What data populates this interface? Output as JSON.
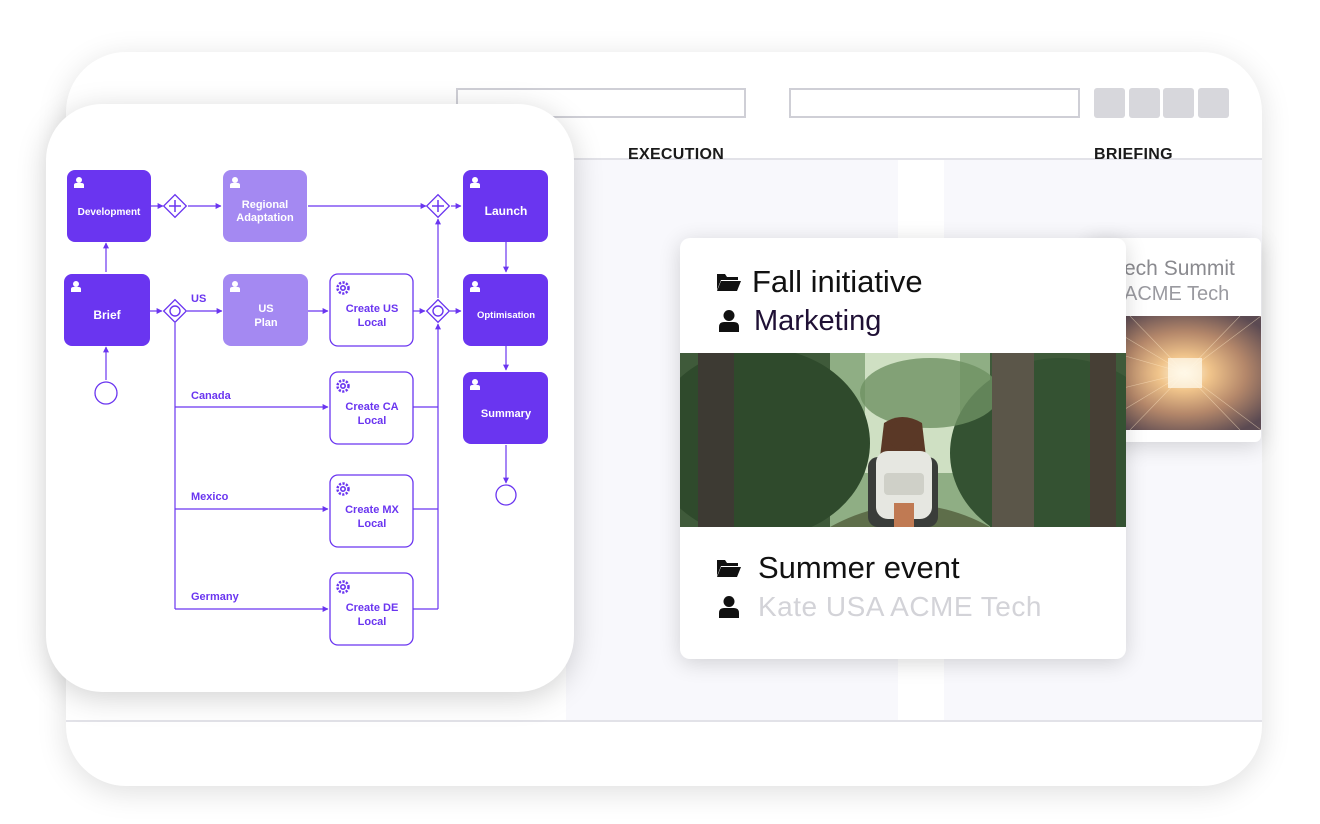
{
  "columns": {
    "execution": "EXECUTION",
    "briefing": "BRIEFING"
  },
  "main_card": {
    "project_1": {
      "title": "Fall initiative",
      "owner": "Marketing"
    },
    "project_2": {
      "title": "Summer event",
      "owner": "Kate USA ACME Tech"
    }
  },
  "side_card": {
    "title": "ech Summit",
    "owner": "ACME Tech"
  },
  "diagram": {
    "nodes": {
      "development": "Development",
      "regional_1": "Regional",
      "regional_2": "Adaptation",
      "launch": "Launch",
      "brief": "Brief",
      "us_plan_1": "US",
      "us_plan_2": "Plan",
      "create_us_1": "Create US",
      "create_us_2": "Local",
      "optimisation": "Optimisation",
      "create_ca_1": "Create CA",
      "create_ca_2": "Local",
      "summary": "Summary",
      "create_mx_1": "Create MX",
      "create_mx_2": "Local",
      "create_de_1": "Create DE",
      "create_de_2": "Local"
    },
    "branches": {
      "us": "US",
      "canada": "Canada",
      "mexico": "Mexico",
      "germany": "Germany"
    }
  },
  "colors": {
    "primary": "#6a35f0",
    "light": "#a489f2",
    "muted_text": "#d3d3d8",
    "owner_text": "#1f1035"
  },
  "icons": {
    "folder": "folder-icon",
    "person": "person-icon",
    "user_task": "user-task-icon",
    "service_task": "gear-icon",
    "gateway_parallel": "parallel-gateway-icon",
    "gateway_inclusive": "inclusive-gateway-icon"
  }
}
